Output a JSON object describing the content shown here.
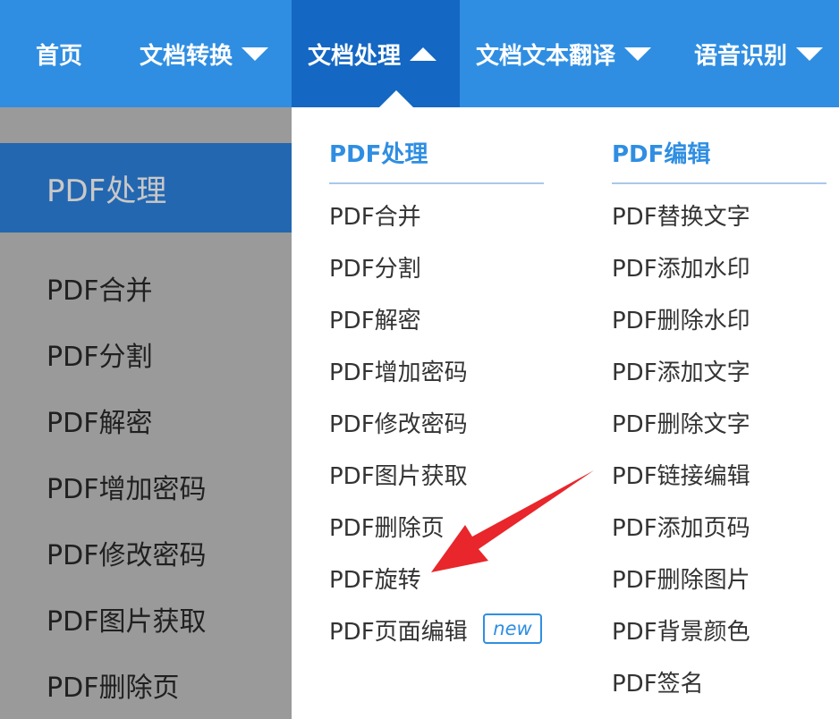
{
  "nav": {
    "items": [
      {
        "label": "首页"
      },
      {
        "label": "文档转换"
      },
      {
        "label": "文档处理"
      },
      {
        "label": "文档文本翻译"
      },
      {
        "label": "语音识别"
      }
    ]
  },
  "sidebar": {
    "header": "PDF处理",
    "items": [
      "PDF合并",
      "PDF分割",
      "PDF解密",
      "PDF增加密码",
      "PDF修改密码",
      "PDF图片获取",
      "PDF删除页"
    ]
  },
  "panel": {
    "col1": {
      "title": "PDF处理",
      "items": [
        "PDF合并",
        "PDF分割",
        "PDF解密",
        "PDF增加密码",
        "PDF修改密码",
        "PDF图片获取",
        "PDF删除页",
        "PDF旋转",
        "PDF页面编辑"
      ],
      "badge": "new"
    },
    "col2": {
      "title": "PDF编辑",
      "items": [
        "PDF替换文字",
        "PDF添加水印",
        "PDF删除水印",
        "PDF添加文字",
        "PDF删除文字",
        "PDF链接编辑",
        "PDF添加页码",
        "PDF删除图片",
        "PDF背景颜色",
        "PDF签名"
      ]
    }
  },
  "colors": {
    "nav_bg": "#2f8ee2",
    "nav_active": "#1467c2",
    "accent": "#2f8ee2",
    "arrow": "#e8262b"
  },
  "icons": [
    "caret-down-icon",
    "caret-up-icon",
    "annotation-arrow-icon"
  ]
}
